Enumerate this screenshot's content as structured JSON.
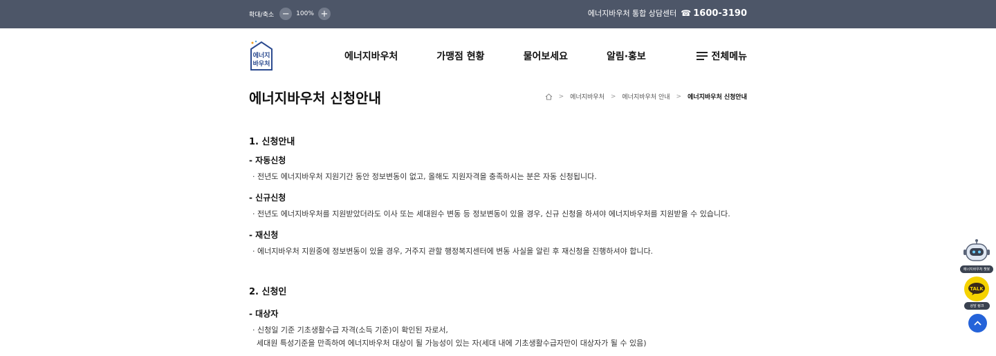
{
  "topbar": {
    "zoom_label": "확대/축소",
    "zoom_out": "−",
    "zoom_value": "100%",
    "zoom_in": "+",
    "callcenter_label": "에너지바우처 통합 상담센터",
    "phone_icon": "☎",
    "callcenter_number": "1600-3190"
  },
  "header": {
    "logo_text_top": "에너지",
    "logo_text_bottom": "바우처",
    "nav": [
      "에너지바우처",
      "가맹점 현황",
      "물어보세요",
      "알림·홍보"
    ],
    "allmenu_label": "전체메뉴"
  },
  "page": {
    "title": "에너지바우처 신청안내",
    "breadcrumb": [
      "에너지바우처",
      "에너지바우처 안내",
      "에너지바우처 신청안내"
    ]
  },
  "content": {
    "section1": {
      "heading": "1. 신청안내",
      "items": [
        {
          "subheading": "- 자동신청",
          "text": "· 전년도 에너지바우처 지원기간 동안 정보변동이 없고, 올해도 지원자격을 충족하시는 분은 자동 신청됩니다."
        },
        {
          "subheading": "- 신규신청",
          "text": "· 전년도 에너지바우처를 지원받았더라도 이사 또는 세대원수 변동 등 정보변동이 있을 경우, 신규 신청을 하셔야 에너지바우처를 지원받을 수 있습니다."
        },
        {
          "subheading": "- 재신청",
          "text": "· 에너지바우처 지원중에 정보변동이 있을 경우, 거주지 관할 행정복지센터에 변동 사실을 알린 후 재신청을 진행하셔야 합니다."
        }
      ]
    },
    "section2": {
      "heading": "2. 신청인",
      "subheading": "- 대상자",
      "line1": "· 신청일 기준 기초생활수급 자격(소득 기준)이 확인된 자로서,",
      "line2": "세대원 특성기준을 만족하여 에너지바우처 대상이 될 가능성이 있는 자(세대 내에 기초생활수급자만이 대상자가 될 수 있음)"
    }
  },
  "floating": {
    "chatbot_label": "에너지바우처 챗봇",
    "talk_icon_text": "TALK",
    "talk_label": "상담 링크",
    "totop_icon": "︿"
  },
  "colors": {
    "topbar": "#4d5668",
    "accent_blue": "#2563d9",
    "kakao_yellow": "#f5d200"
  }
}
